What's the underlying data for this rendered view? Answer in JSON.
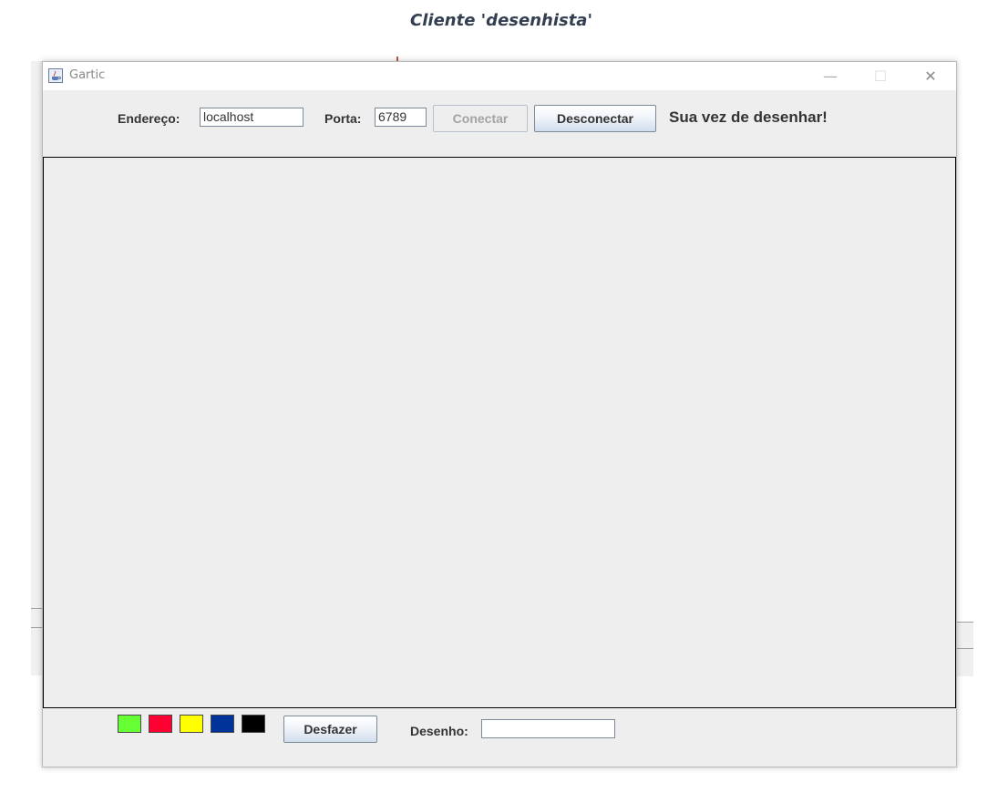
{
  "caption": "Cliente 'desenhista'",
  "window": {
    "title": "Gartic",
    "controls": {
      "minimize": "—",
      "maximize": "☐",
      "close": "✕"
    }
  },
  "toolbar": {
    "address_label": "Endereço:",
    "address_value": "localhost",
    "port_label": "Porta:",
    "port_value": "6789",
    "connect_label": "Conectar",
    "disconnect_label": "Desconectar",
    "status_text": "Sua vez de desenhar!"
  },
  "bottom": {
    "colors": [
      {
        "name": "green",
        "hex": "#66ff33"
      },
      {
        "name": "red",
        "hex": "#ff0033"
      },
      {
        "name": "yellow",
        "hex": "#ffff00"
      },
      {
        "name": "blue",
        "hex": "#003399"
      },
      {
        "name": "black",
        "hex": "#000000"
      }
    ],
    "undo_label": "Desfazer",
    "drawing_label": "Desenho:",
    "drawing_value": ""
  },
  "icons": {
    "app": "java-coffee-cup-icon"
  }
}
